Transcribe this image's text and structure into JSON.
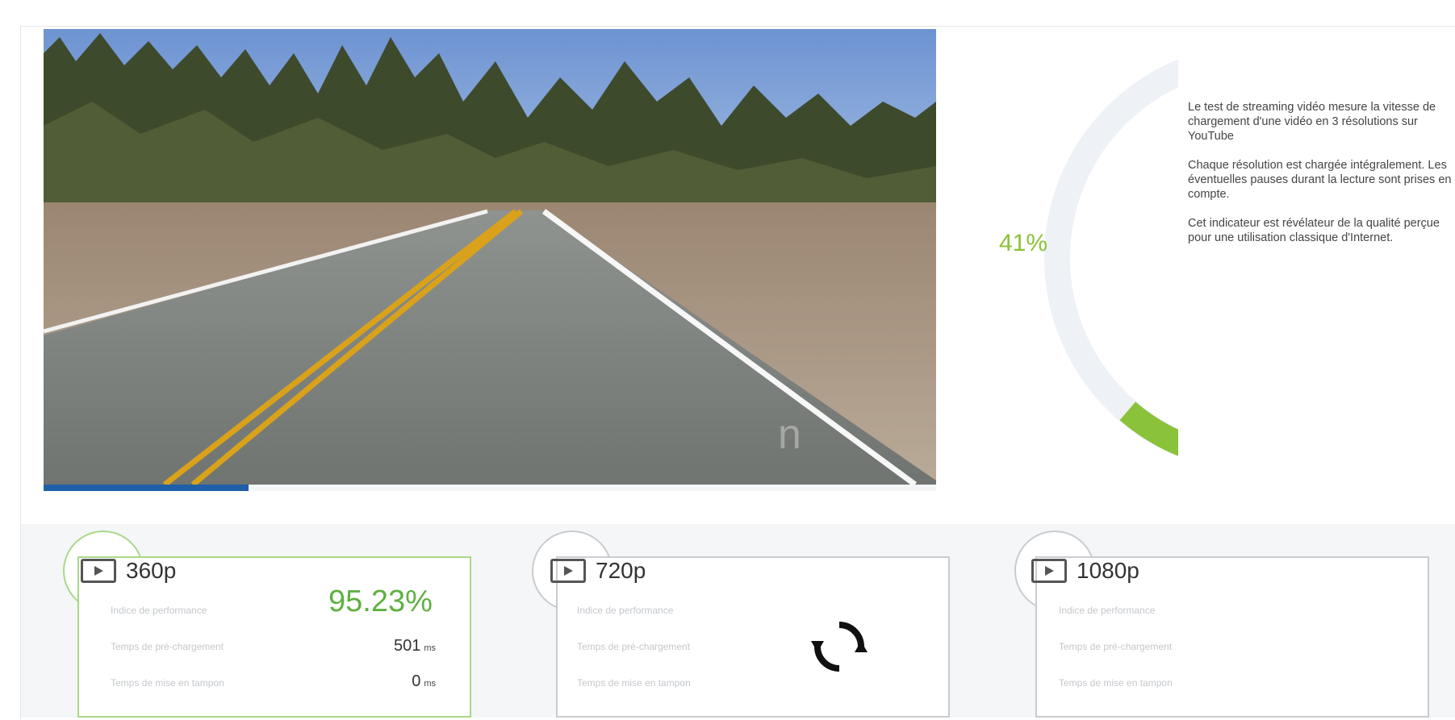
{
  "player": {
    "progress_fraction": 0.23,
    "watermark": "n",
    "colors": {
      "progress": "#1f5fa8"
    }
  },
  "gauge": {
    "percent_label": "41%",
    "percent_value": 41,
    "colors": {
      "arc": "#8ac23a",
      "track": "#eef1f6"
    }
  },
  "description": {
    "paragraphs": [
      "Le test de streaming vidéo mesure la vitesse de chargement d'une vidéo en 3 résolutions sur YouTube",
      "Chaque résolution est chargée intégralement. Les éventuelles pauses durant la lecture sont prises en compte.",
      "Cet indicateur est révélateur de la qualité perçue pour une utilisation classique d'Internet."
    ]
  },
  "cards": [
    {
      "resolution": "360p",
      "status": "done",
      "labels": [
        "Indice de performance",
        "Temps de pré-chargement",
        "Temps de mise en tampon"
      ],
      "performance": "95.23%",
      "preload_value": "501",
      "preload_unit": "ms",
      "buffer_value": "0",
      "buffer_unit": "ms"
    },
    {
      "resolution": "720p",
      "status": "loading",
      "labels": [
        "Indice de performance",
        "Temps de pré-chargement",
        "Temps de mise en tampon"
      ]
    },
    {
      "resolution": "1080p",
      "status": "pending",
      "labels": [
        "Indice de performance",
        "Temps de pré-chargement",
        "Temps de mise en tampon"
      ]
    }
  ],
  "icons": {
    "play": "play-icon",
    "spinner": "refresh-spinner-icon"
  },
  "colors": {
    "success": "#5fb042",
    "card_border": "#c9ccd0",
    "card_border_done": "#a9d889"
  }
}
